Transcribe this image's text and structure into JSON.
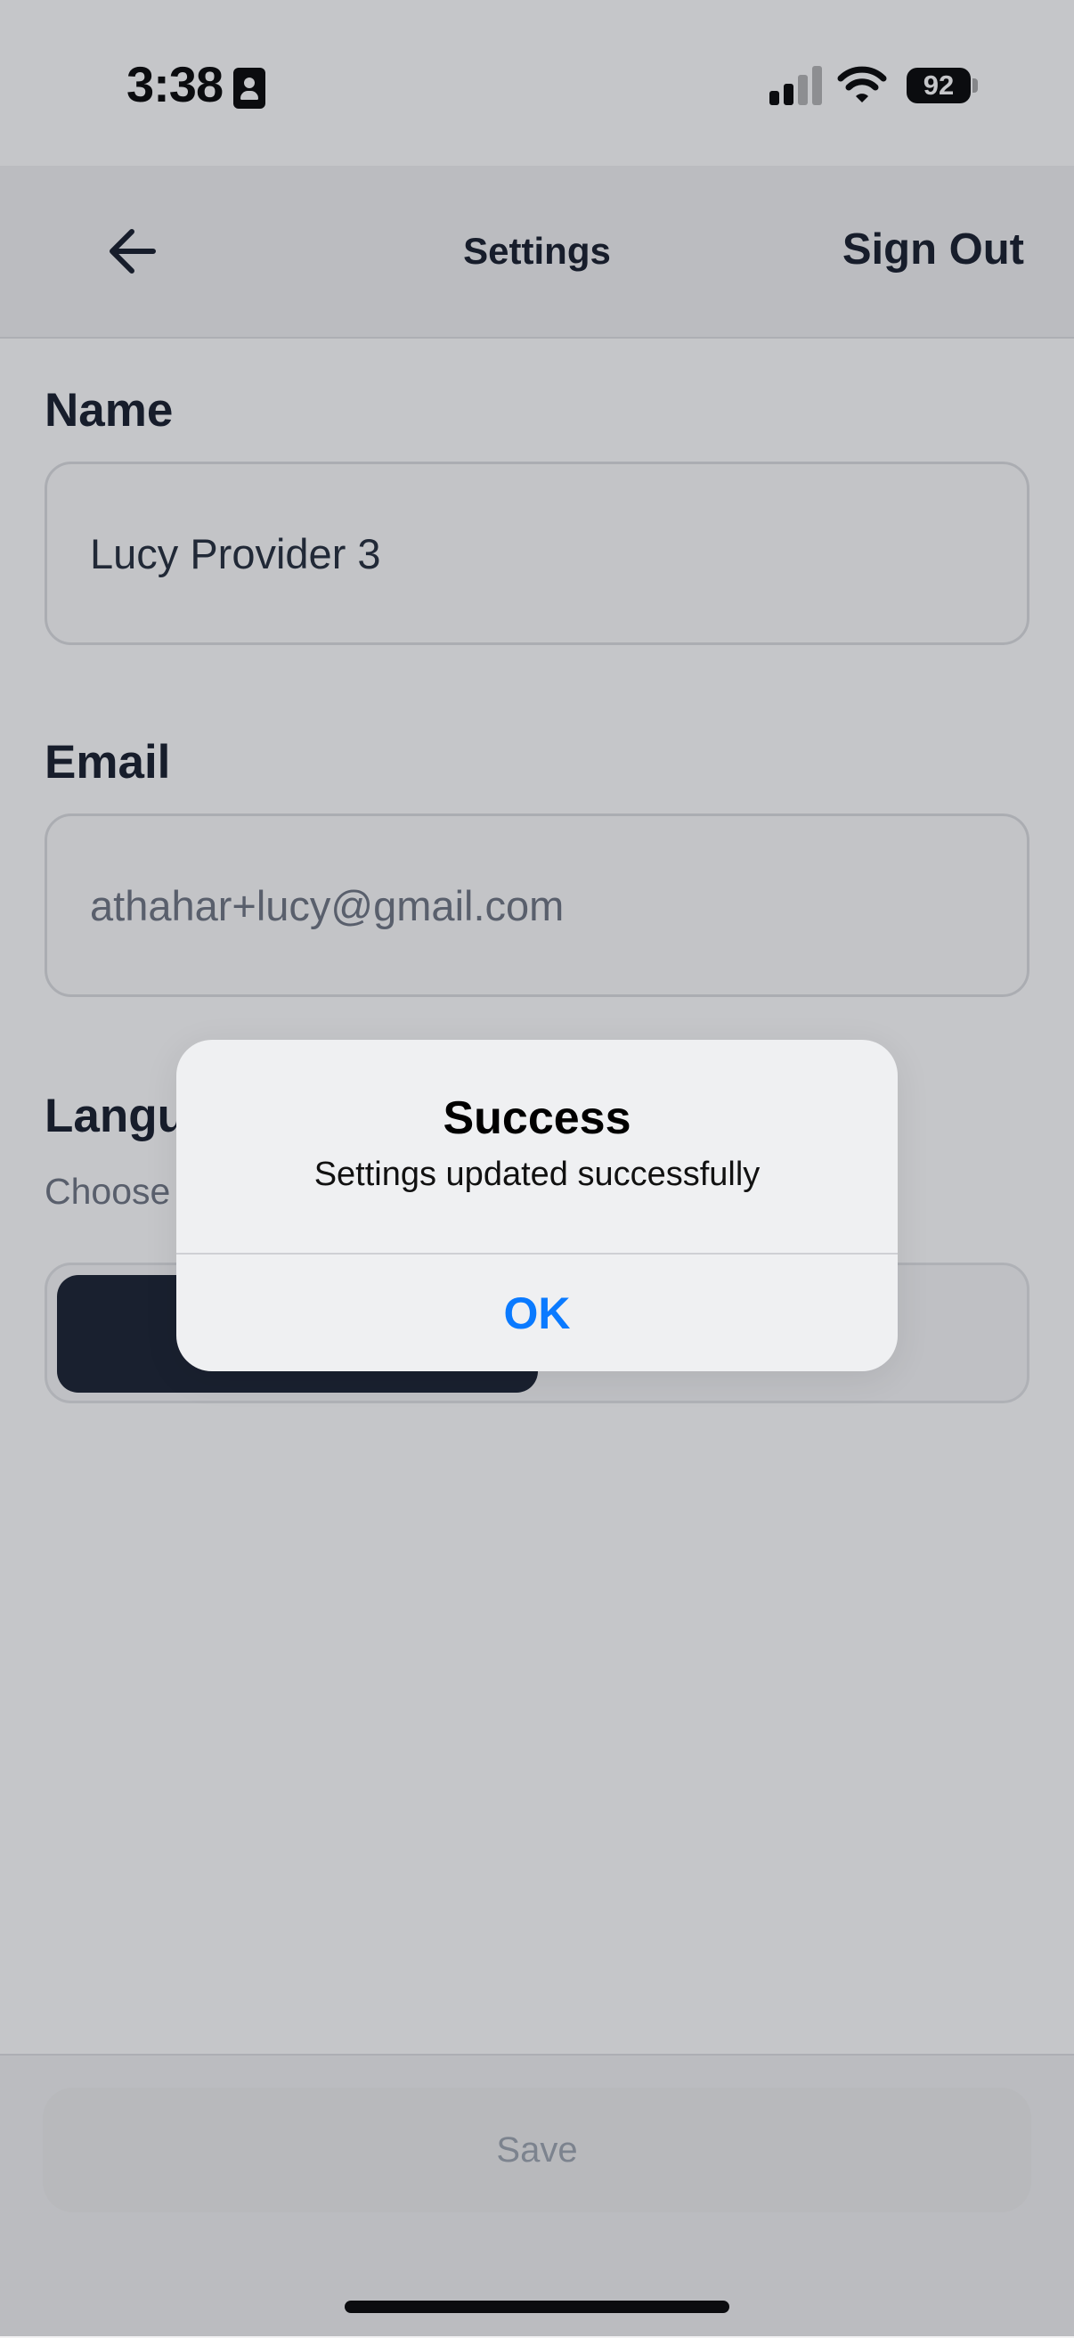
{
  "status_bar": {
    "time": "3:38",
    "battery": "92",
    "signal_bars_active": 2,
    "signal_bars_total": 4,
    "icons": [
      "id-badge-icon",
      "cellular-signal-icon",
      "wifi-icon",
      "battery-icon"
    ]
  },
  "header": {
    "back_icon": "arrow-left-icon",
    "title": "Settings",
    "sign_out_label": "Sign Out"
  },
  "form": {
    "name_label": "Name",
    "name_value": "Lucy Provider 3",
    "email_label": "Email",
    "email_value": "athahar+lucy@gmail.com",
    "language_label": "Langu",
    "language_helper": "Choose"
  },
  "footer": {
    "save_label": "Save"
  },
  "alert": {
    "title": "Success",
    "message": "Settings updated successfully",
    "ok_label": "OK"
  },
  "colors": {
    "accent_blue": "#0a7aff",
    "segment_active": "#141c2c",
    "text_primary": "#111827",
    "text_muted": "#6b7280"
  }
}
